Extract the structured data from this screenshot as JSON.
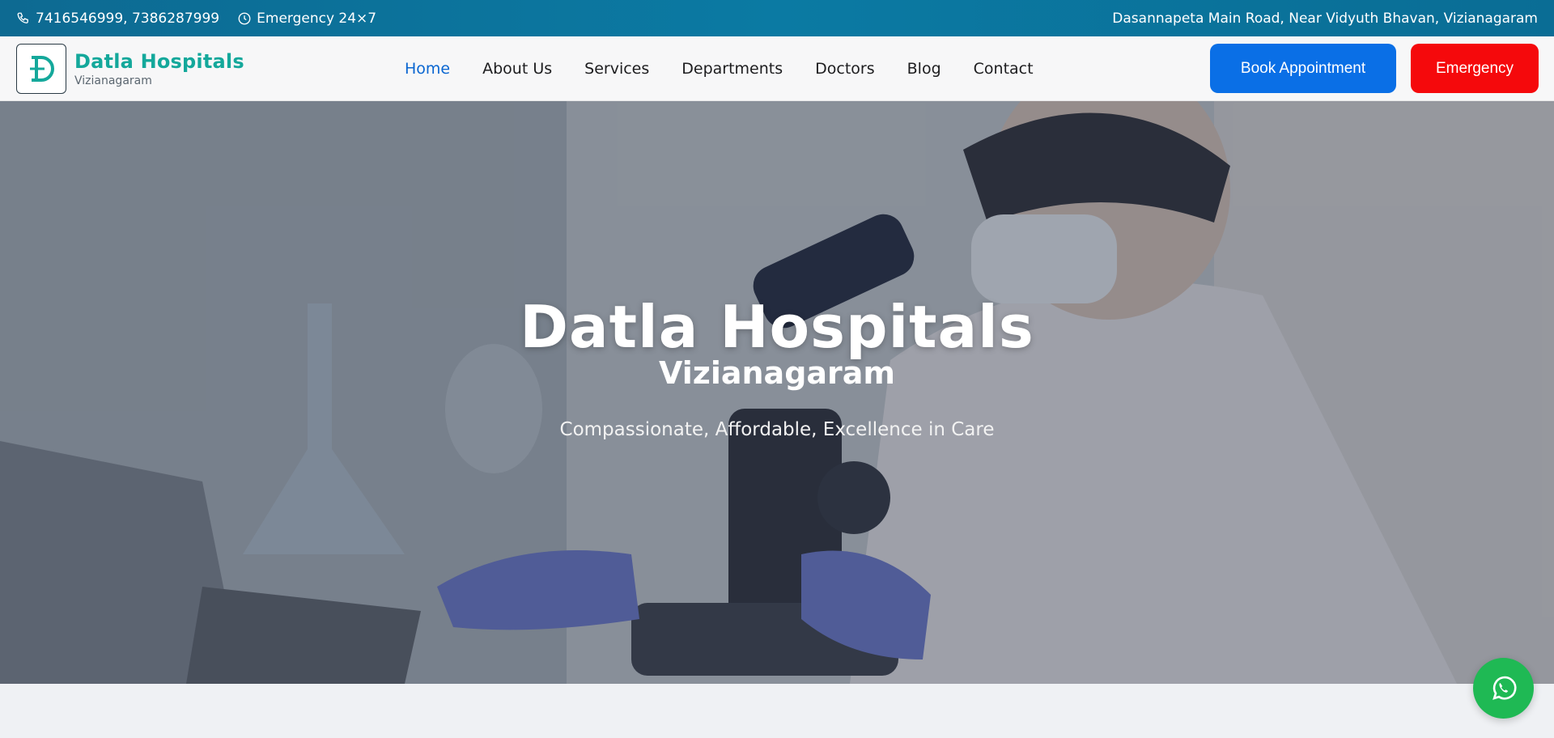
{
  "topbar": {
    "phones": "7416546999, 7386287999",
    "emergency": "Emergency 24×7",
    "address": "Dasannapeta Main Road, Near Vidyuth Bhavan, Vizianagaram"
  },
  "header": {
    "brand_name": "Datla Hospitals",
    "brand_city": "Vizianagaram",
    "nav": [
      "Home",
      "About Us",
      "Services",
      "Departments",
      "Doctors",
      "Blog",
      "Contact"
    ],
    "book_label": "Book Appointment",
    "emergency_label": "Emergency"
  },
  "hero": {
    "title": "Datla Hospitals",
    "subtitle": "Vizianagaram",
    "tagline": "Compassionate, Affordable, Excellence in Care"
  },
  "colors": {
    "topbar": "#0b7aa3",
    "brand": "#14a89b",
    "primary": "#0a6fe6",
    "emergency": "#f5090c",
    "whatsapp": "#1fb954"
  }
}
